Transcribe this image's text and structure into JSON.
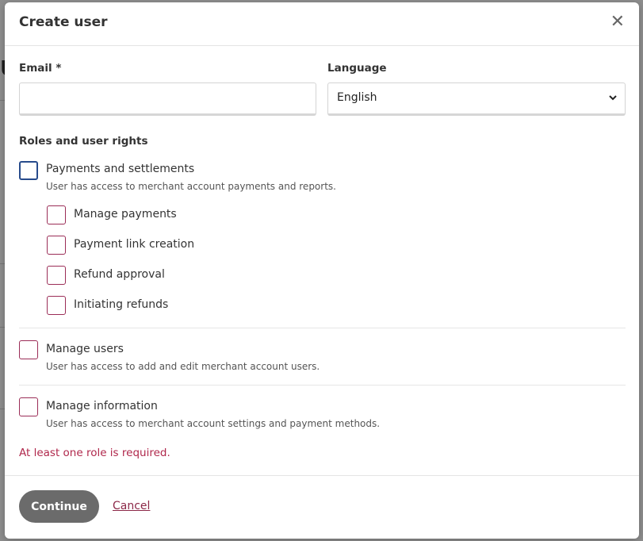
{
  "dialog": {
    "title": "Create user",
    "close_icon": "close-icon"
  },
  "form": {
    "email_label": "Email *",
    "email_value": "",
    "language_label": "Language",
    "language_selected": "English"
  },
  "roles": {
    "title": "Roles and user rights",
    "groups": [
      {
        "label": "Payments and settlements",
        "description": "User has access to merchant account payments and reports.",
        "checked": false,
        "children": [
          {
            "label": "Manage payments",
            "checked": false
          },
          {
            "label": "Payment link creation",
            "checked": false
          },
          {
            "label": "Refund approval",
            "checked": false
          },
          {
            "label": "Initiating refunds",
            "checked": false
          }
        ]
      },
      {
        "label": "Manage users",
        "description": "User has access to add and edit merchant account users.",
        "checked": false
      },
      {
        "label": "Manage information",
        "description": "User has access to merchant account settings and payment methods.",
        "checked": false
      }
    ]
  },
  "error": "At least one role is required.",
  "footer": {
    "continue_label": "Continue",
    "cancel_label": "Cancel"
  },
  "colors": {
    "accent": "#9b2d57",
    "focus_border": "#274b8c",
    "error": "#b0284c",
    "button_bg": "#6b6b6b"
  }
}
